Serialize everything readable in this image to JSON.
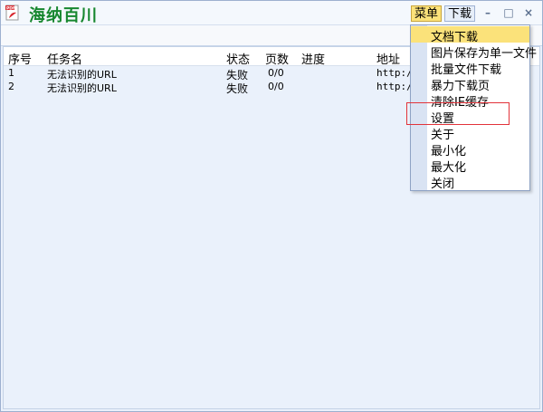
{
  "app": {
    "title": "海纳百川"
  },
  "header": {
    "menu_label": "菜单",
    "download_label": "下载",
    "minimize_glyph": "–",
    "maximize_glyph": "□",
    "close_glyph": "×"
  },
  "table": {
    "columns": [
      "序号",
      "任务名",
      "状态",
      "页数",
      "进度",
      "地址"
    ],
    "rows": [
      {
        "index": "1",
        "name": "无法识别的URL",
        "status": "失败",
        "pages": "0/0",
        "progress": "",
        "url": "http:/"
      },
      {
        "index": "2",
        "name": "无法识别的URL",
        "status": "失败",
        "pages": "0/0",
        "progress": "",
        "url": "http:/"
      }
    ]
  },
  "menu": {
    "items": [
      "文档下载",
      "图片保存为单一文件",
      "批量文件下载",
      "暴力下载页",
      "清除IE缓存",
      "设置",
      "关于",
      "最小化",
      "最大化",
      "关闭"
    ],
    "active_index": 0,
    "highlighted_index": 5
  },
  "colors": {
    "title_green": "#17872f",
    "accent_yellow": "#fbe27a",
    "highlight_red": "#e2333a"
  },
  "icons": {
    "app_icon": "pdf-document-icon"
  }
}
